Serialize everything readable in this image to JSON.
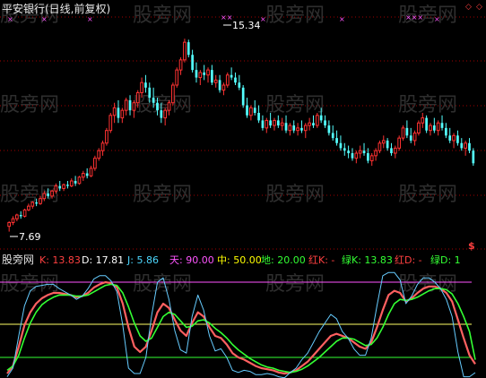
{
  "watermark": "股旁网",
  "main_panel": {
    "title": "平安银行(日线,前复权)",
    "high_label": "15.34",
    "low_label": "7.69",
    "right_markers": [
      "◇",
      "◇"
    ],
    "corner_symbol": "$"
  },
  "kdj_panel": {
    "brand": "股旁网",
    "stats": [
      {
        "label": "K: 13.83",
        "color": "#ff4040"
      },
      {
        "label": "D: 17.81",
        "color": "#ffffff"
      },
      {
        "label": "J: 5.86",
        "color": "#4dd8ff"
      },
      {
        "label": "天: 90.00",
        "color": "#ff55ff"
      },
      {
        "label": "中: 50.00",
        "color": "#ffff00"
      },
      {
        "label": "地: 20.00",
        "color": "#33ff33"
      },
      {
        "label": "红K: -",
        "color": "#ff4040"
      },
      {
        "label": "绿K: 13.83",
        "color": "#33ff33"
      },
      {
        "label": "红D: -",
        "color": "#ff4040"
      },
      {
        "label": "绿D: 1",
        "color": "#33ff33"
      }
    ]
  },
  "colors": {
    "up": "#ff3232",
    "down": "#54ffff",
    "grid": "#8b0000",
    "level_high": "#ff55ff",
    "level_mid": "#ffff66",
    "level_low": "#33ff33",
    "k_line": "#ff6060",
    "d_line": "#33ff33",
    "j_line": "#66ccff"
  },
  "chart_data": [
    {
      "type": "candlestick",
      "title": "平安银行(日线,前复权)",
      "ylim": [
        7.0,
        16.2
      ],
      "annotations": [
        {
          "text": "15.34",
          "y": 15.34
        },
        {
          "text": "7.69",
          "y": 7.69
        }
      ],
      "ohlc": [
        [
          7.9,
          8.1,
          7.69,
          8.05
        ],
        [
          8.05,
          8.3,
          7.95,
          8.2
        ],
        [
          8.2,
          8.4,
          8.1,
          8.35
        ],
        [
          8.35,
          8.5,
          8.2,
          8.3
        ],
        [
          8.3,
          8.6,
          8.25,
          8.55
        ],
        [
          8.55,
          8.8,
          8.5,
          8.7
        ],
        [
          8.7,
          8.9,
          8.6,
          8.85
        ],
        [
          8.85,
          9.0,
          8.7,
          8.8
        ],
        [
          8.8,
          9.1,
          8.75,
          9.0
        ],
        [
          9.0,
          9.3,
          8.9,
          9.2
        ],
        [
          9.2,
          9.4,
          9.0,
          9.1
        ],
        [
          9.1,
          9.35,
          9.0,
          9.3
        ],
        [
          9.3,
          9.6,
          9.2,
          9.5
        ],
        [
          9.5,
          9.7,
          9.3,
          9.4
        ],
        [
          9.4,
          9.6,
          9.3,
          9.55
        ],
        [
          9.55,
          9.7,
          9.4,
          9.5
        ],
        [
          9.5,
          9.8,
          9.45,
          9.7
        ],
        [
          9.7,
          9.9,
          9.5,
          9.6
        ],
        [
          9.6,
          9.9,
          9.55,
          9.85
        ],
        [
          9.85,
          10.1,
          9.7,
          10.0
        ],
        [
          10.0,
          10.2,
          9.8,
          9.9
        ],
        [
          9.9,
          10.3,
          9.85,
          10.2
        ],
        [
          10.2,
          10.7,
          10.1,
          10.6
        ],
        [
          10.6,
          11.0,
          10.5,
          10.9
        ],
        [
          10.9,
          11.3,
          10.7,
          11.2
        ],
        [
          11.2,
          11.8,
          11.1,
          11.7
        ],
        [
          11.7,
          12.4,
          11.6,
          12.3
        ],
        [
          12.3,
          12.8,
          12.0,
          12.6
        ],
        [
          12.6,
          12.9,
          12.0,
          12.2
        ],
        [
          12.2,
          12.6,
          12.0,
          12.5
        ],
        [
          12.5,
          13.0,
          12.3,
          12.9
        ],
        [
          12.9,
          13.1,
          12.3,
          12.5
        ],
        [
          12.5,
          12.9,
          12.2,
          12.8
        ],
        [
          12.8,
          13.3,
          12.6,
          13.2
        ],
        [
          13.2,
          13.8,
          13.0,
          13.6
        ],
        [
          13.6,
          13.9,
          13.2,
          13.4
        ],
        [
          13.4,
          13.6,
          12.8,
          13.0
        ],
        [
          13.0,
          13.4,
          12.6,
          12.8
        ],
        [
          12.8,
          13.0,
          12.3,
          12.5
        ],
        [
          12.5,
          12.8,
          12.0,
          12.2
        ],
        [
          12.2,
          12.6,
          11.9,
          12.5
        ],
        [
          12.5,
          12.9,
          12.3,
          12.8
        ],
        [
          12.8,
          13.6,
          12.7,
          13.5
        ],
        [
          13.5,
          14.2,
          13.4,
          14.1
        ],
        [
          14.1,
          14.6,
          13.9,
          14.5
        ],
        [
          14.5,
          15.34,
          14.4,
          15.2
        ],
        [
          15.2,
          15.3,
          14.6,
          14.7
        ],
        [
          14.7,
          14.9,
          14.0,
          14.1
        ],
        [
          14.1,
          14.4,
          13.6,
          13.8
        ],
        [
          13.8,
          14.1,
          13.5,
          14.0
        ],
        [
          14.0,
          14.3,
          13.7,
          13.9
        ],
        [
          13.9,
          14.2,
          13.6,
          14.1
        ],
        [
          14.1,
          14.3,
          13.5,
          13.6
        ],
        [
          13.6,
          13.9,
          13.4,
          13.7
        ],
        [
          13.7,
          13.9,
          13.2,
          13.3
        ],
        [
          13.3,
          13.6,
          13.1,
          13.5
        ],
        [
          13.5,
          14.0,
          13.4,
          13.9
        ],
        [
          13.9,
          14.2,
          13.7,
          13.8
        ],
        [
          13.8,
          14.0,
          13.5,
          13.6
        ],
        [
          13.6,
          13.9,
          13.3,
          13.4
        ],
        [
          13.4,
          13.5,
          12.6,
          12.7
        ],
        [
          12.7,
          13.0,
          12.2,
          12.3
        ],
        [
          12.3,
          12.7,
          12.1,
          12.6
        ],
        [
          12.6,
          12.9,
          12.3,
          12.4
        ],
        [
          12.4,
          12.7,
          12.0,
          12.1
        ],
        [
          12.1,
          12.3,
          11.7,
          11.8
        ],
        [
          11.8,
          12.2,
          11.6,
          12.1
        ],
        [
          12.1,
          12.4,
          11.8,
          11.9
        ],
        [
          11.9,
          12.2,
          11.7,
          12.1
        ],
        [
          12.1,
          12.3,
          11.8,
          11.9
        ],
        [
          11.9,
          12.2,
          11.7,
          12.0
        ],
        [
          12.0,
          12.3,
          11.6,
          11.7
        ],
        [
          11.7,
          12.0,
          11.5,
          11.9
        ],
        [
          11.9,
          12.1,
          11.6,
          11.7
        ],
        [
          11.7,
          12.0,
          11.5,
          11.8
        ],
        [
          11.8,
          12.1,
          11.6,
          11.7
        ],
        [
          11.7,
          12.0,
          11.4,
          11.9
        ],
        [
          11.9,
          12.2,
          11.7,
          12.0
        ],
        [
          12.0,
          12.3,
          11.8,
          11.9
        ],
        [
          11.9,
          12.4,
          11.8,
          12.3
        ],
        [
          12.3,
          12.6,
          12.0,
          12.1
        ],
        [
          12.1,
          12.3,
          11.8,
          11.9
        ],
        [
          11.9,
          12.1,
          11.5,
          11.6
        ],
        [
          11.6,
          11.9,
          11.3,
          11.4
        ],
        [
          11.4,
          11.7,
          11.1,
          11.2
        ],
        [
          11.2,
          11.5,
          10.9,
          11.0
        ],
        [
          11.0,
          11.2,
          10.7,
          10.9
        ],
        [
          10.9,
          11.1,
          10.6,
          10.8
        ],
        [
          10.8,
          11.0,
          10.5,
          10.6
        ],
        [
          10.6,
          10.9,
          10.4,
          10.8
        ],
        [
          10.8,
          11.1,
          10.6,
          10.9
        ],
        [
          10.9,
          11.2,
          10.7,
          10.8
        ],
        [
          10.8,
          11.0,
          10.4,
          10.5
        ],
        [
          10.5,
          10.8,
          10.3,
          10.7
        ],
        [
          10.7,
          11.0,
          10.5,
          10.9
        ],
        [
          10.9,
          11.3,
          10.8,
          11.2
        ],
        [
          11.2,
          11.5,
          11.0,
          11.3
        ],
        [
          11.3,
          11.4,
          10.9,
          11.0
        ],
        [
          11.0,
          11.2,
          10.7,
          10.8
        ],
        [
          10.8,
          11.1,
          10.6,
          11.0
        ],
        [
          11.0,
          11.5,
          10.9,
          11.4
        ],
        [
          11.4,
          11.9,
          11.3,
          11.8
        ],
        [
          11.8,
          12.1,
          11.4,
          11.5
        ],
        [
          11.5,
          11.8,
          11.2,
          11.3
        ],
        [
          11.3,
          11.7,
          11.1,
          11.6
        ],
        [
          11.6,
          12.1,
          11.5,
          12.0
        ],
        [
          12.0,
          12.4,
          11.8,
          12.2
        ],
        [
          12.2,
          12.3,
          11.6,
          11.7
        ],
        [
          11.7,
          12.0,
          11.5,
          11.9
        ],
        [
          11.9,
          12.2,
          11.6,
          11.7
        ],
        [
          11.7,
          12.1,
          11.5,
          12.0
        ],
        [
          12.0,
          12.3,
          11.7,
          11.8
        ],
        [
          11.8,
          12.0,
          11.4,
          11.5
        ],
        [
          11.5,
          11.8,
          11.2,
          11.3
        ],
        [
          11.3,
          11.6,
          11.0,
          11.5
        ],
        [
          11.5,
          11.7,
          11.1,
          11.2
        ],
        [
          11.2,
          11.4,
          10.9,
          11.0
        ],
        [
          11.0,
          11.3,
          10.7,
          11.2
        ],
        [
          11.2,
          11.4,
          10.8,
          10.9
        ],
        [
          10.9,
          11.0,
          10.3,
          10.4
        ]
      ]
    },
    {
      "type": "line",
      "levels": [
        {
          "name": "天",
          "value": 90
        },
        {
          "name": "中",
          "value": 50
        },
        {
          "name": "地",
          "value": 20
        }
      ],
      "ylim": [
        0,
        100
      ],
      "series": [
        {
          "name": "K",
          "values": [
            5,
            12,
            30,
            50,
            62,
            70,
            75,
            78,
            80,
            80,
            79,
            78,
            76,
            77,
            80,
            85,
            88,
            90,
            89,
            85,
            70,
            48,
            30,
            25,
            30,
            45,
            62,
            70,
            66,
            55,
            45,
            40,
            52,
            62,
            58,
            48,
            40,
            38,
            32,
            24,
            20,
            18,
            15,
            12,
            10,
            9,
            8,
            6,
            5,
            6,
            8,
            12,
            16,
            22,
            28,
            34,
            40,
            42,
            40,
            38,
            34,
            30,
            28,
            34,
            48,
            64,
            78,
            82,
            80,
            72,
            75,
            80,
            84,
            86,
            86,
            84,
            80,
            72,
            55,
            38,
            22,
            13.83
          ]
        },
        {
          "name": "D",
          "values": [
            8,
            12,
            22,
            38,
            52,
            62,
            69,
            73,
            76,
            78,
            78,
            78,
            77,
            77,
            78,
            81,
            84,
            87,
            88,
            87,
            80,
            67,
            52,
            40,
            35,
            38,
            48,
            58,
            62,
            60,
            54,
            48,
            49,
            54,
            55,
            52,
            47,
            43,
            38,
            32,
            27,
            23,
            19,
            16,
            13,
            11,
            10,
            8,
            7,
            6,
            7,
            9,
            12,
            16,
            20,
            25,
            30,
            35,
            38,
            38,
            37,
            34,
            31,
            32,
            38,
            48,
            60,
            70,
            74,
            73,
            74,
            76,
            79,
            82,
            84,
            84,
            83,
            79,
            70,
            58,
            44,
            17.81
          ]
        },
        {
          "name": "J",
          "values": [
            2,
            10,
            40,
            68,
            82,
            86,
            87,
            88,
            88,
            84,
            81,
            78,
            74,
            77,
            84,
            93,
            96,
            96,
            91,
            81,
            50,
            10,
            5,
            5,
            20,
            59,
            90,
            94,
            74,
            45,
            27,
            24,
            58,
            78,
            64,
            40,
            26,
            28,
            20,
            8,
            6,
            8,
            7,
            4,
            4,
            5,
            4,
            2,
            1,
            6,
            10,
            18,
            24,
            34,
            44,
            52,
            60,
            56,
            44,
            38,
            28,
            22,
            22,
            38,
            68,
            96,
            99,
            99,
            92,
            70,
            77,
            88,
            94,
            94,
            90,
            84,
            74,
            58,
            25,
            2,
            2,
            5.86
          ]
        }
      ]
    }
  ]
}
